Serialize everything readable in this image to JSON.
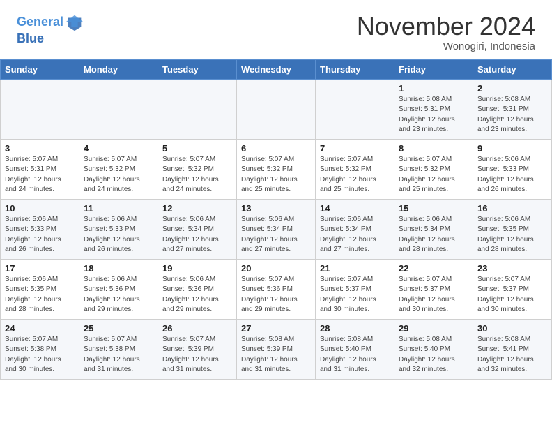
{
  "header": {
    "logo_line1": "General",
    "logo_line2": "Blue",
    "month": "November 2024",
    "location": "Wonogiri, Indonesia"
  },
  "weekdays": [
    "Sunday",
    "Monday",
    "Tuesday",
    "Wednesday",
    "Thursday",
    "Friday",
    "Saturday"
  ],
  "weeks": [
    [
      {
        "day": "",
        "info": ""
      },
      {
        "day": "",
        "info": ""
      },
      {
        "day": "",
        "info": ""
      },
      {
        "day": "",
        "info": ""
      },
      {
        "day": "",
        "info": ""
      },
      {
        "day": "1",
        "info": "Sunrise: 5:08 AM\nSunset: 5:31 PM\nDaylight: 12 hours\nand 23 minutes."
      },
      {
        "day": "2",
        "info": "Sunrise: 5:08 AM\nSunset: 5:31 PM\nDaylight: 12 hours\nand 23 minutes."
      }
    ],
    [
      {
        "day": "3",
        "info": "Sunrise: 5:07 AM\nSunset: 5:31 PM\nDaylight: 12 hours\nand 24 minutes."
      },
      {
        "day": "4",
        "info": "Sunrise: 5:07 AM\nSunset: 5:32 PM\nDaylight: 12 hours\nand 24 minutes."
      },
      {
        "day": "5",
        "info": "Sunrise: 5:07 AM\nSunset: 5:32 PM\nDaylight: 12 hours\nand 24 minutes."
      },
      {
        "day": "6",
        "info": "Sunrise: 5:07 AM\nSunset: 5:32 PM\nDaylight: 12 hours\nand 25 minutes."
      },
      {
        "day": "7",
        "info": "Sunrise: 5:07 AM\nSunset: 5:32 PM\nDaylight: 12 hours\nand 25 minutes."
      },
      {
        "day": "8",
        "info": "Sunrise: 5:07 AM\nSunset: 5:32 PM\nDaylight: 12 hours\nand 25 minutes."
      },
      {
        "day": "9",
        "info": "Sunrise: 5:06 AM\nSunset: 5:33 PM\nDaylight: 12 hours\nand 26 minutes."
      }
    ],
    [
      {
        "day": "10",
        "info": "Sunrise: 5:06 AM\nSunset: 5:33 PM\nDaylight: 12 hours\nand 26 minutes."
      },
      {
        "day": "11",
        "info": "Sunrise: 5:06 AM\nSunset: 5:33 PM\nDaylight: 12 hours\nand 26 minutes."
      },
      {
        "day": "12",
        "info": "Sunrise: 5:06 AM\nSunset: 5:34 PM\nDaylight: 12 hours\nand 27 minutes."
      },
      {
        "day": "13",
        "info": "Sunrise: 5:06 AM\nSunset: 5:34 PM\nDaylight: 12 hours\nand 27 minutes."
      },
      {
        "day": "14",
        "info": "Sunrise: 5:06 AM\nSunset: 5:34 PM\nDaylight: 12 hours\nand 27 minutes."
      },
      {
        "day": "15",
        "info": "Sunrise: 5:06 AM\nSunset: 5:34 PM\nDaylight: 12 hours\nand 28 minutes."
      },
      {
        "day": "16",
        "info": "Sunrise: 5:06 AM\nSunset: 5:35 PM\nDaylight: 12 hours\nand 28 minutes."
      }
    ],
    [
      {
        "day": "17",
        "info": "Sunrise: 5:06 AM\nSunset: 5:35 PM\nDaylight: 12 hours\nand 28 minutes."
      },
      {
        "day": "18",
        "info": "Sunrise: 5:06 AM\nSunset: 5:36 PM\nDaylight: 12 hours\nand 29 minutes."
      },
      {
        "day": "19",
        "info": "Sunrise: 5:06 AM\nSunset: 5:36 PM\nDaylight: 12 hours\nand 29 minutes."
      },
      {
        "day": "20",
        "info": "Sunrise: 5:07 AM\nSunset: 5:36 PM\nDaylight: 12 hours\nand 29 minutes."
      },
      {
        "day": "21",
        "info": "Sunrise: 5:07 AM\nSunset: 5:37 PM\nDaylight: 12 hours\nand 30 minutes."
      },
      {
        "day": "22",
        "info": "Sunrise: 5:07 AM\nSunset: 5:37 PM\nDaylight: 12 hours\nand 30 minutes."
      },
      {
        "day": "23",
        "info": "Sunrise: 5:07 AM\nSunset: 5:37 PM\nDaylight: 12 hours\nand 30 minutes."
      }
    ],
    [
      {
        "day": "24",
        "info": "Sunrise: 5:07 AM\nSunset: 5:38 PM\nDaylight: 12 hours\nand 30 minutes."
      },
      {
        "day": "25",
        "info": "Sunrise: 5:07 AM\nSunset: 5:38 PM\nDaylight: 12 hours\nand 31 minutes."
      },
      {
        "day": "26",
        "info": "Sunrise: 5:07 AM\nSunset: 5:39 PM\nDaylight: 12 hours\nand 31 minutes."
      },
      {
        "day": "27",
        "info": "Sunrise: 5:08 AM\nSunset: 5:39 PM\nDaylight: 12 hours\nand 31 minutes."
      },
      {
        "day": "28",
        "info": "Sunrise: 5:08 AM\nSunset: 5:40 PM\nDaylight: 12 hours\nand 31 minutes."
      },
      {
        "day": "29",
        "info": "Sunrise: 5:08 AM\nSunset: 5:40 PM\nDaylight: 12 hours\nand 32 minutes."
      },
      {
        "day": "30",
        "info": "Sunrise: 5:08 AM\nSunset: 5:41 PM\nDaylight: 12 hours\nand 32 minutes."
      }
    ]
  ]
}
